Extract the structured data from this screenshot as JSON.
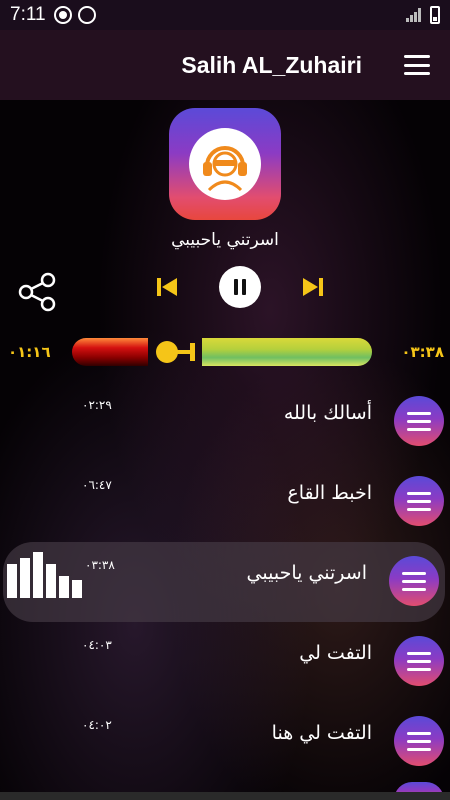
{
  "status_bar": {
    "time": "7:11"
  },
  "app_bar": {
    "title": "Salih AL_Zuhairi"
  },
  "player": {
    "now_playing": "اسرتني ياحبيبي",
    "elapsed": "٠١:١٦",
    "total": "٠٣:٣٨",
    "progress": 0.35
  },
  "tracks": [
    {
      "name": "أسالك بالله",
      "duration": "٠٢:٢٩",
      "active": false
    },
    {
      "name": "اخبط القاع",
      "duration": "٠٦:٤٧",
      "active": false
    },
    {
      "name": "اسرتني ياحبيبي",
      "duration": "٠٣:٣٨",
      "active": true
    },
    {
      "name": "التفت لي",
      "duration": "٠٤:٠٣",
      "active": false
    },
    {
      "name": "التفت لي هنا",
      "duration": "٠٤:٠٢",
      "active": false
    }
  ],
  "icons": {
    "menu": "hamburger-menu-icon",
    "logo": "headphones-person-icon",
    "share": "share-icon",
    "prev": "skip-previous-icon",
    "play_pause": "pause-icon",
    "next": "skip-next-icon",
    "equalizer": "equalizer-bars-icon"
  },
  "colors": {
    "accent": "#f5c518",
    "purple": "#5b4ad8",
    "pink": "#e24d6f"
  }
}
